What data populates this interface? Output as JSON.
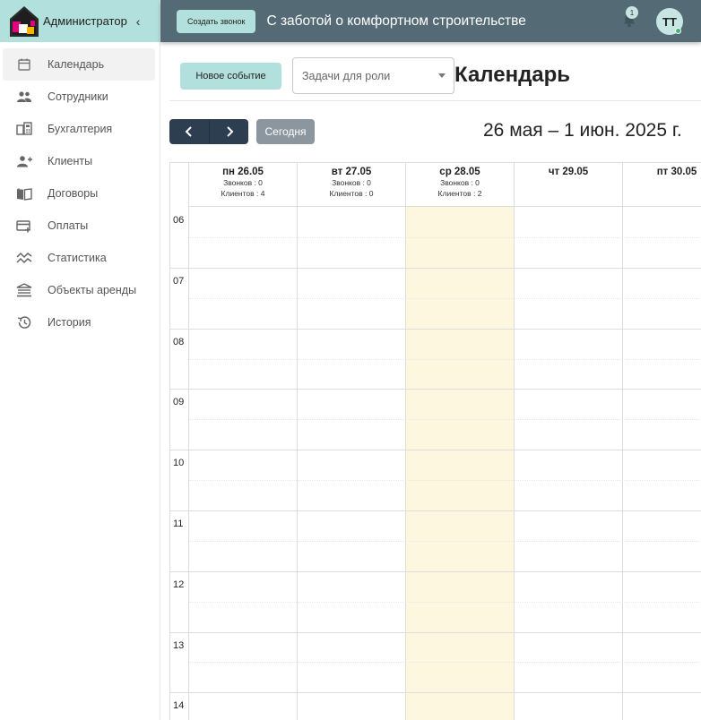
{
  "sidebar": {
    "title": "Администратор",
    "items": [
      {
        "label": "Календарь",
        "icon": "calendar-icon",
        "active": true
      },
      {
        "label": "Сотрудники",
        "icon": "people-icon"
      },
      {
        "label": "Бухгалтерия",
        "icon": "accounting-icon"
      },
      {
        "label": "Клиенты",
        "icon": "add-user-icon"
      },
      {
        "label": "Договоры",
        "icon": "book-icon"
      },
      {
        "label": "Оплаты",
        "icon": "credit-card-icon"
      },
      {
        "label": "Статистика",
        "icon": "stats-icon"
      },
      {
        "label": "Объекты аренды",
        "icon": "building-icon"
      },
      {
        "label": "История",
        "icon": "history-icon"
      }
    ]
  },
  "topbar": {
    "call_button": "Создать звонок",
    "company": "С заботой о комфортном строительстве",
    "notifications_count": "1",
    "avatar_initials": "ТТ"
  },
  "toolbar": {
    "new_event": "Новое событие",
    "role_select_placeholder": "Задачи для роли",
    "page_title": "Календарь",
    "today": "Сегодня",
    "range": "26 мая – 1 июн. 2025 г."
  },
  "calendar": {
    "days": [
      {
        "name": "пн 26.05",
        "calls": "Звонков : 0",
        "clients": "Клиентов : 4",
        "today": false
      },
      {
        "name": "вт 27.05",
        "calls": "Звонков : 0",
        "clients": "Клиентов : 0",
        "today": false
      },
      {
        "name": "ср 28.05",
        "calls": "Звонков : 0",
        "clients": "Клиентов : 2",
        "today": true
      },
      {
        "name": "чт 29.05",
        "calls": "",
        "clients": "",
        "today": false
      },
      {
        "name": "пт 30.05",
        "calls": "",
        "clients": "",
        "today": false
      }
    ],
    "hours": [
      "06",
      "07",
      "08",
      "09",
      "10",
      "11",
      "12",
      "13",
      "14"
    ]
  },
  "colors": {
    "accent": "#b2e0dc",
    "topbar": "#546b76",
    "nav_button": "#2c3e50",
    "today_column": "#fef7e0"
  }
}
